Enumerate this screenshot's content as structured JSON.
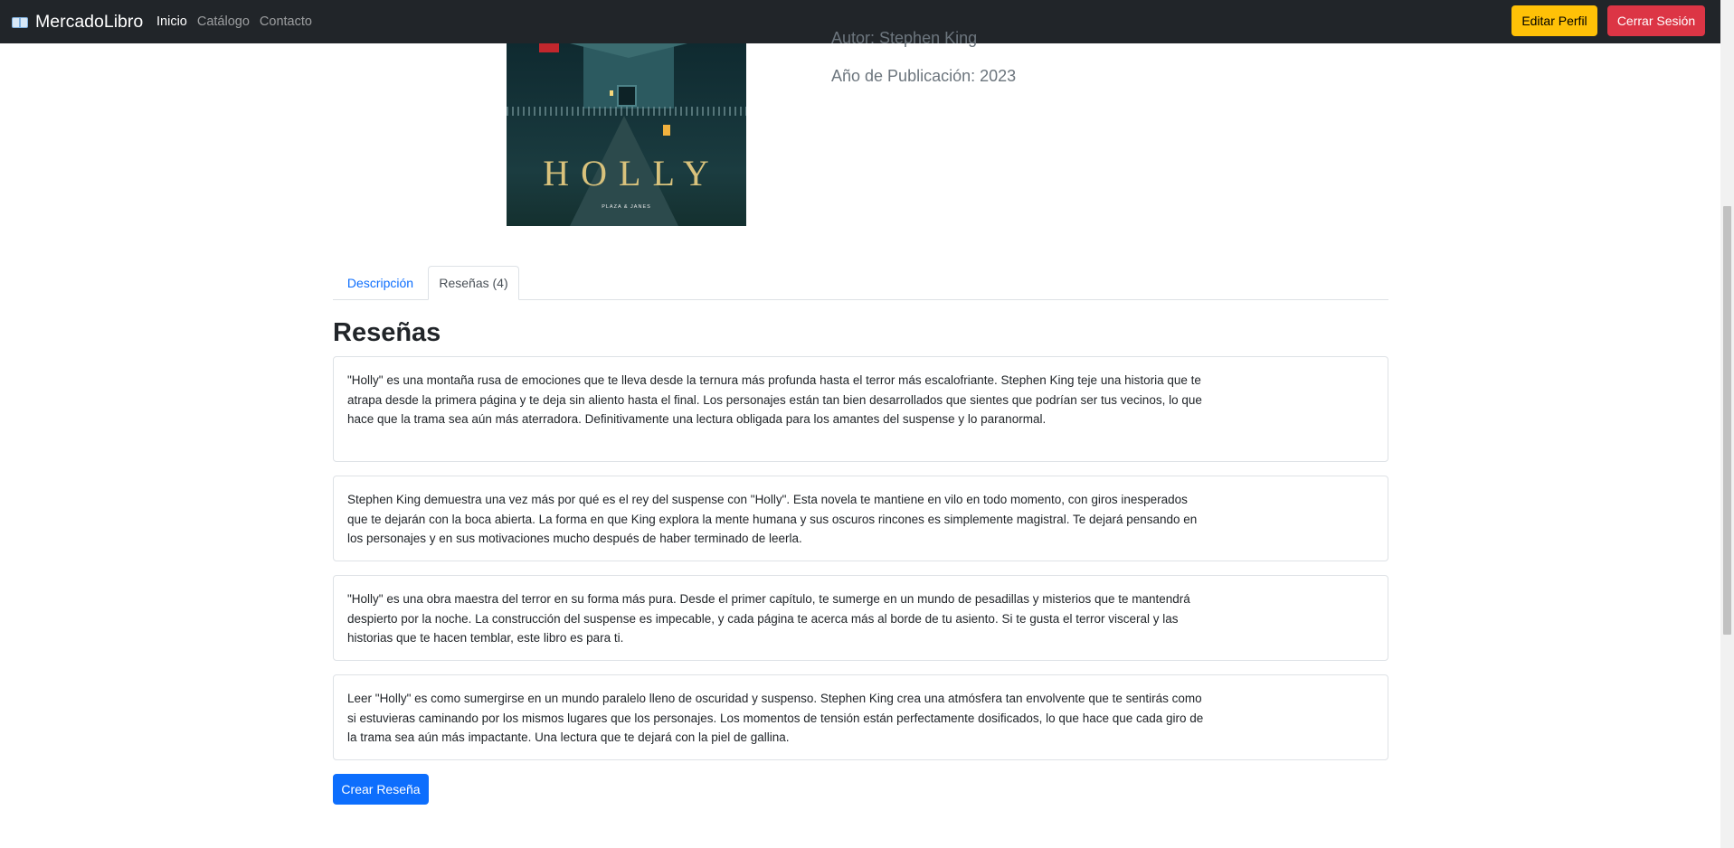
{
  "navbar": {
    "brand": "MercadoLibro",
    "links": [
      "Inicio",
      "Catálogo",
      "Contacto"
    ],
    "edit_profile": "Editar Perfil",
    "logout": "Cerrar Sesión"
  },
  "book": {
    "cover_title": "HOLLY",
    "cover_publisher": "PLAZA & JANES",
    "author_line": "Autor: Stephen King",
    "year_line": "Año de Publicación: 2023"
  },
  "tabs": [
    "Descripción",
    "Reseñas (4)"
  ],
  "reviews_section": {
    "title": "Reseñas",
    "reviews": [
      "\"Holly\" es una montaña rusa de emociones que te lleva desde la ternura más profunda hasta el terror más escalofriante. Stephen King teje una historia que te atrapa desde la primera página y te deja sin aliento hasta el final. Los personajes están tan bien desarrollados que sientes que podrían ser tus vecinos, lo que hace que la trama sea aún más aterradora. Definitivamente una lectura obligada para los amantes del suspense y lo paranormal.",
      "Stephen King demuestra una vez más por qué es el rey del suspense con \"Holly\". Esta novela te mantiene en vilo en todo momento, con giros inesperados que te dejarán con la boca abierta. La forma en que King explora la mente humana y sus oscuros rincones es simplemente magistral. Te dejará pensando en los personajes y en sus motivaciones mucho después de haber terminado de leerla.",
      "\"Holly\" es una obra maestra del terror en su forma más pura. Desde el primer capítulo, te sumerge en un mundo de pesadillas y misterios que te mantendrá despierto por la noche. La construcción del suspense es impecable, y cada página te acerca más al borde de tu asiento. Si te gusta el terror visceral y las historias que te hacen temblar, este libro es para ti.",
      "Leer \"Holly\" es como sumergirse en un mundo paralelo lleno de oscuridad y suspenso. Stephen King crea una atmósfera tan envolvente que te sentirás como si estuvieras caminando por los mismos lugares que los personajes. Los momentos de tensión están perfectamente dosificados, lo que hace que cada giro de la trama sea aún más impactante. Una lectura que te dejará con la piel de gallina."
    ],
    "create_button": "Crear Reseña"
  },
  "icons": {
    "brand": "open-book-icon"
  },
  "colors": {
    "navbar": "#212529",
    "warning": "#ffc107",
    "danger": "#dc3545",
    "primary": "#0d6efd"
  }
}
